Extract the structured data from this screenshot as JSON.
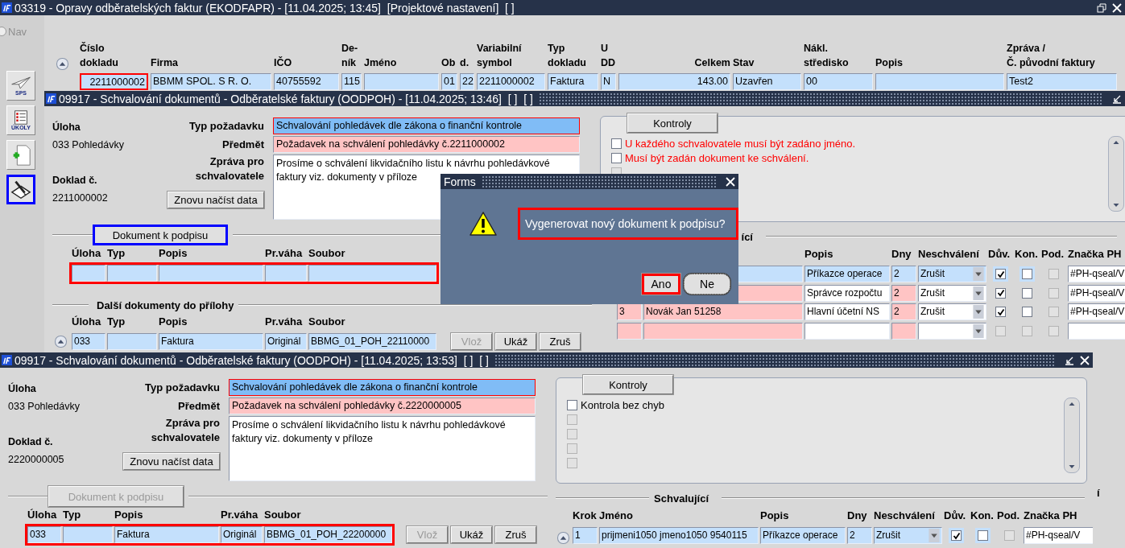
{
  "main_window": {
    "title": "03319 - Opravy odběratelských faktur (EKODFAPR) - [11.04.2025; 13:45]  [Projektové nastavení]  [ ]",
    "nav": {
      "label": "Nav",
      "disabled": true
    },
    "tools": [
      {
        "kind": "plane",
        "label": "SPS",
        "highlighted": false
      },
      {
        "kind": "tasks",
        "label": "ÚKOLY",
        "highlighted": false
      },
      {
        "kind": "add",
        "highlighted": false
      },
      {
        "kind": "sign",
        "highlighted": true
      }
    ],
    "columns": [
      {
        "lines": [
          "Číslo",
          "dokladu"
        ]
      },
      {
        "lines": [
          "Firma"
        ]
      },
      {
        "lines": [
          "IČO"
        ]
      },
      {
        "lines": [
          "De-",
          "ník"
        ]
      },
      {
        "lines": [
          "Jméno"
        ]
      },
      {
        "lines": [
          "Ob"
        ]
      },
      {
        "lines": [
          "d."
        ]
      },
      {
        "lines": [
          "Variabilní",
          "symbol"
        ]
      },
      {
        "lines": [
          "Typ",
          "dokladu"
        ]
      },
      {
        "lines": [
          "U",
          "DD"
        ]
      },
      {
        "lines": [
          "Celkem"
        ]
      },
      {
        "lines": [
          "Stav"
        ]
      },
      {
        "lines": [
          "Nákl.",
          "středisko"
        ]
      },
      {
        "lines": [
          "Popis"
        ]
      },
      {
        "lines": [
          "Zpráva /",
          "Č. původní faktury"
        ]
      }
    ],
    "row": [
      {
        "text": "2211000002",
        "highlighted": true
      },
      {
        "text": "BBMM SPOL. S R. O.",
        "highlighted": false
      },
      {
        "text": "40755592",
        "highlighted": false
      },
      {
        "text": "115",
        "highlighted": false
      },
      {
        "highlighted": false
      },
      {
        "text": "01",
        "highlighted": false
      },
      {
        "text": "22",
        "highlighted": false
      },
      {
        "text": "2211000002",
        "highlighted": false
      },
      {
        "text": "Faktura",
        "highlighted": false
      },
      {
        "text": "N",
        "highlighted": false
      },
      {
        "text": "143.00",
        "highlighted": false
      },
      {
        "text": "Uzavřen",
        "highlighted": false
      },
      {
        "text": "00",
        "highlighted": false
      },
      {
        "highlighted": false
      },
      {
        "text": "Test2",
        "highlighted": false
      }
    ]
  },
  "approval_windows": [
    {
      "title": "09917 - Schvalování dokumentů - Odběratelské faktury (OODPOH) - [11.04.2025; 13:46]  [ ]  [ ]",
      "closable": false,
      "task_label": "Úloha",
      "task_value": "033 Pohledávky",
      "doc_label": "Doklad č.",
      "doc_value": "2211000002",
      "fields": [
        {
          "label": "Typ požadavku",
          "value": "Schvalování pohledávek dle zákona o finanční kontrole",
          "kind": "selected",
          "focused": true
        },
        {
          "label": "Předmět",
          "value": "Požadavek na schválení pohledávky č.2211000002",
          "kind": "required",
          "focused": false
        },
        {
          "label": "Zpráva pro schvalovatele",
          "value": "Prosíme o schválení likvidačního listu k návrhu pohledávkové\nfaktury viz. dokumenty v příloze",
          "kind": "memo",
          "focused": false
        }
      ],
      "reload_button": "Znovu načíst data",
      "sign_section": {
        "button": {
          "label": "Dokument k podpisu",
          "disabled": false,
          "highlighted": true
        },
        "columns": [
          "Úloha",
          "Typ",
          "Popis",
          "Pr.váha",
          "Soubor"
        ],
        "row": {
          "highlighted": true
        }
      },
      "attachments": {
        "heading": "Další dokumenty do přílohy",
        "columns": [
          "Úloha",
          "Typ",
          "Popis",
          "Pr.váha",
          "Soubor"
        ],
        "row": {
          "highlighted": false,
          "task": "033",
          "description": "Faktura",
          "weight": "Originál",
          "file": "BBMG_01_POH_22110000"
        },
        "actions": [
          {
            "label": "Vlož",
            "disabled": true
          },
          {
            "label": "Ukáž",
            "disabled": false
          },
          {
            "label": "Zruš",
            "disabled": false
          }
        ]
      },
      "checks": {
        "tab": "Kontroly",
        "items": [
          {
            "text": "U každého schvalovatele musí být zadáno jméno.",
            "error": true,
            "checked": false,
            "disabled": false
          },
          {
            "text": "Musí být zadán dokument ke schválení.",
            "error": true,
            "checked": false,
            "disabled": false
          },
          {
            "disabled": true
          }
        ]
      },
      "approvers": {
        "heading": "ící",
        "columns": [
          "Popis",
          "Dny",
          "Neschválení",
          "Dův.",
          "Kon.",
          "Pod.",
          "Značka PH"
        ],
        "rows": [
          {
            "current": true,
            "description": "Příkazce operace",
            "days": "2",
            "reject": "Zrušit",
            "reason": {
              "checked": true,
              "disabled": false
            },
            "control": {
              "checked": false,
              "disabled": false
            },
            "sign": {
              "checked": false,
              "disabled": true
            },
            "tag": "#PH-qseal/V"
          },
          {
            "current": false,
            "description": "Správce rozpočtu",
            "days": "2",
            "reject": "Zrušit",
            "reason": {
              "checked": true,
              "disabled": false
            },
            "control": {
              "checked": false,
              "disabled": false
            },
            "sign": {
              "checked": false,
              "disabled": true
            },
            "tag": "#PH-qseal/V"
          },
          {
            "current": false,
            "step": "3",
            "name": "Novák Jan 51258",
            "description": "Hlavní účetní NS",
            "days": "2",
            "reject": "Zrušit",
            "reason": {
              "checked": true,
              "disabled": false
            },
            "control": {
              "checked": false,
              "disabled": false
            },
            "sign": {
              "checked": false,
              "disabled": true
            },
            "tag": "#PH-qseal/V"
          },
          {
            "current": false,
            "reason": {
              "checked": false,
              "disabled": true
            },
            "control": {
              "checked": false,
              "disabled": true
            },
            "sign": {
              "checked": false,
              "disabled": true
            }
          }
        ]
      },
      "section_fragment": "í"
    },
    {
      "title": "09917 - Schvalování dokumentů - Odběratelské faktury (OODPOH) - [11.04.2025; 13:53]  [ ]  [ ]",
      "closable": true,
      "task_label": "Úloha",
      "task_value": "033 Pohledávky",
      "doc_label": "Doklad č.",
      "doc_value": "2220000005",
      "fields": [
        {
          "label": "Typ požadavku",
          "value": "Schvalování pohledávek dle zákona o finanční kontrole",
          "kind": "selected",
          "focused": true
        },
        {
          "label": "Předmět",
          "value": "Požadavek na schválení pohledávky č.2220000005",
          "kind": "required",
          "focused": false
        },
        {
          "label": "Zpráva pro schvalovatele",
          "value": "Prosíme o schválení likvidačního listu k návrhu pohledávkové\nfaktury viz. dokumenty v příloze",
          "kind": "memo",
          "focused": false
        }
      ],
      "reload_button": "Znovu načíst data",
      "sign_section": {
        "button": {
          "label": "Dokument k podpisu",
          "disabled": true,
          "highlighted": false
        },
        "columns": [
          "Úloha",
          "Typ",
          "Popis",
          "Pr.váha",
          "Soubor"
        ],
        "row": {
          "highlighted": true,
          "task": "033",
          "description": "Faktura",
          "weight": "Originál",
          "file": "BBMG_01_POH_22200000"
        },
        "actions": [
          {
            "label": "Vlož",
            "disabled": true
          },
          {
            "label": "Ukáž",
            "disabled": false
          },
          {
            "label": "Zruš",
            "disabled": false
          }
        ]
      },
      "checks": {
        "tab": "Kontroly",
        "items": [
          {
            "text": "Kontrola bez chyb",
            "error": false,
            "checked": false,
            "disabled": false
          },
          {
            "checked": false,
            "disabled": true
          },
          {
            "checked": false,
            "disabled": true
          },
          {
            "checked": false,
            "disabled": true
          },
          {
            "checked": false,
            "disabled": true
          }
        ]
      },
      "approvers": {
        "heading": "Schvalující",
        "columns": [
          "Krok",
          "Jméno",
          "Popis",
          "Dny",
          "Neschválení",
          "Dův.",
          "Kon.",
          "Pod.",
          "Značka PH"
        ],
        "rows": [
          {
            "current": true,
            "step": "1",
            "name": "prijmeni1050 jmeno1050 9540115",
            "description": "Příkazce operace",
            "days": "2",
            "reject": "Zrušit",
            "reason": {
              "checked": true,
              "disabled": false
            },
            "control": {
              "checked": false,
              "disabled": false
            },
            "sign": {
              "checked": false,
              "disabled": true
            },
            "tag": "#PH-qseal/V"
          }
        ]
      }
    }
  ],
  "dialog": {
    "title": "Forms",
    "message": "Vygenerovat nový dokument k podpisu?",
    "highlighted": true,
    "buttons": [
      {
        "label": "Ano",
        "highlighted": true,
        "focused": false
      },
      {
        "label": "Ne",
        "highlighted": false,
        "focused": true
      }
    ]
  }
}
